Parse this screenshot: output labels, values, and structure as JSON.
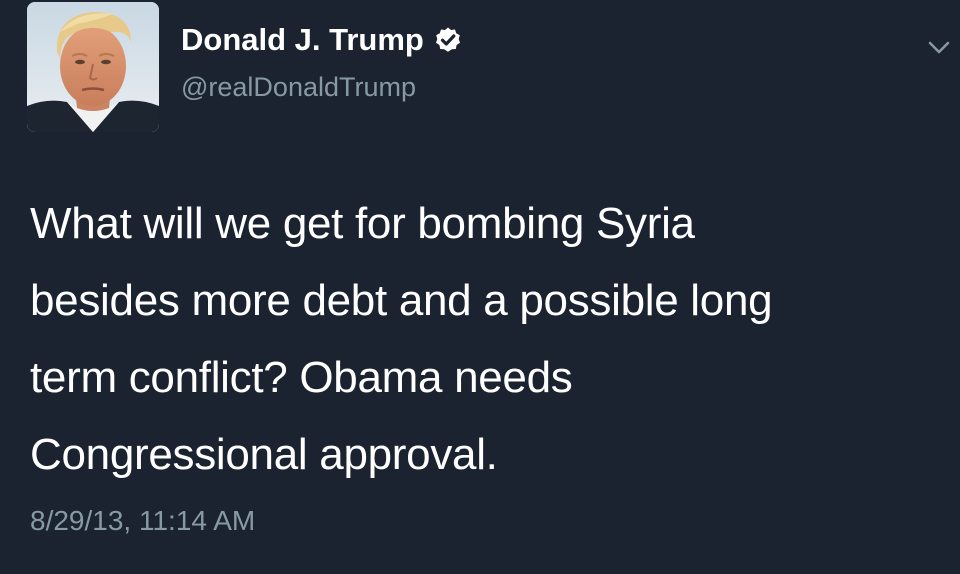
{
  "author": {
    "display_name": "Donald J. Trump",
    "handle": "@realDonaldTrump",
    "verified": true,
    "avatar_icon": "profile-photo"
  },
  "tweet": {
    "lines": [
      "What will we get for bombing Syria",
      "besides more debt and a possible long",
      "term conflict? Obama needs",
      "Congressional approval."
    ],
    "timestamp": "8/29/13, 11:14 AM"
  },
  "menu": {
    "icon": "chevron-down-icon"
  },
  "colors": {
    "background": "#1b2330",
    "text": "#ffffff",
    "secondary_text": "#8899a6",
    "verified_badge": "#ffffff"
  }
}
